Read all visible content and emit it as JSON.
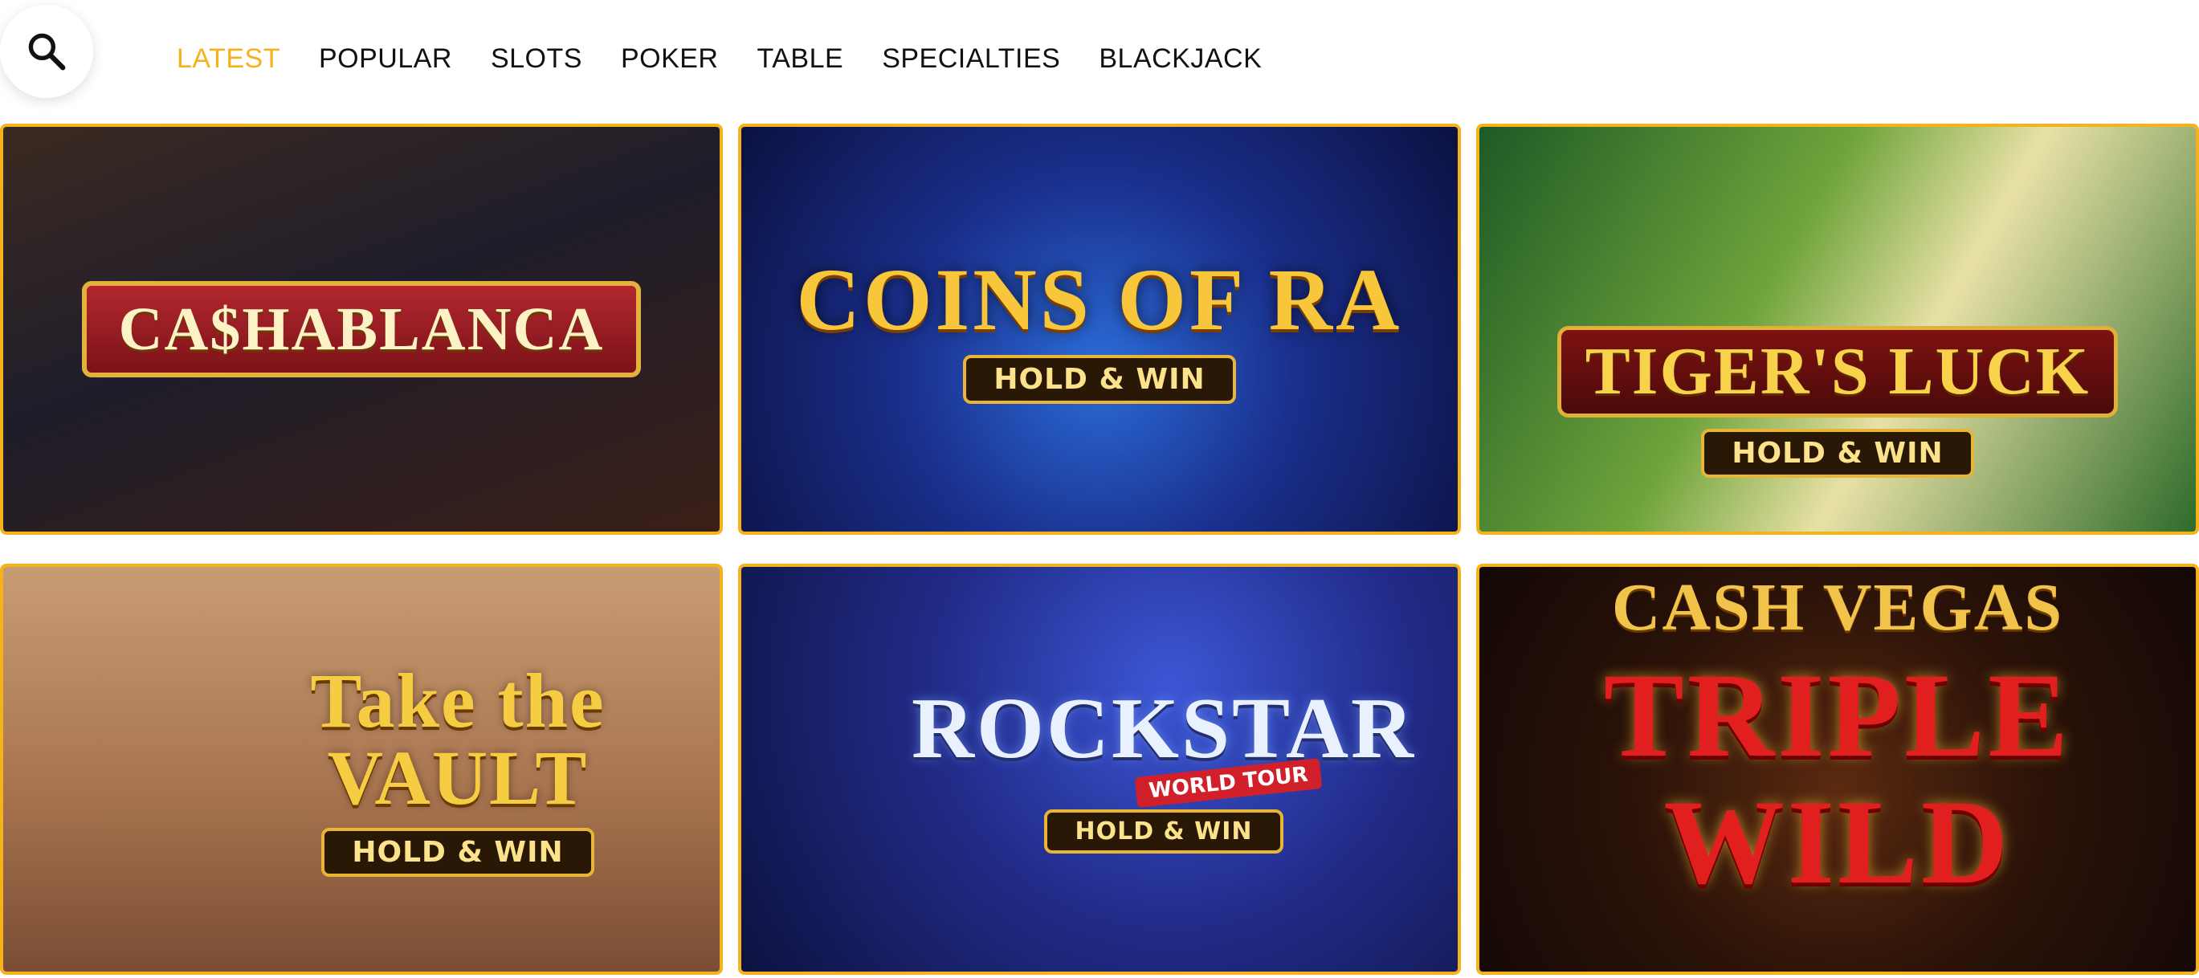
{
  "search": {
    "icon": "search-icon"
  },
  "nav": {
    "items": [
      {
        "label": "LATEST",
        "active": true
      },
      {
        "label": "POPULAR",
        "active": false
      },
      {
        "label": "SLOTS",
        "active": false
      },
      {
        "label": "POKER",
        "active": false
      },
      {
        "label": "TABLE",
        "active": false
      },
      {
        "label": "SPECIALTIES",
        "active": false
      },
      {
        "label": "BLACKJACK",
        "active": false
      }
    ],
    "active_color": "#f6b21b",
    "text_color": "#111111"
  },
  "games": [
    {
      "title": "CA$HABLANCA",
      "badge": ""
    },
    {
      "title": "COINS OF RA",
      "badge": "HOLD & WIN"
    },
    {
      "title": "TIGER'S LUCK",
      "badge": "HOLD & WIN"
    },
    {
      "title": "Take the VAULT",
      "badge": "HOLD & WIN"
    },
    {
      "title": "ROCKSTAR",
      "subtitle": "WORLD TOUR",
      "badge": "HOLD & WIN"
    },
    {
      "brand": "CASH VEGAS",
      "title": "TRIPLE WILD",
      "badge": ""
    }
  ],
  "tile_border_color": "#f6b21b"
}
